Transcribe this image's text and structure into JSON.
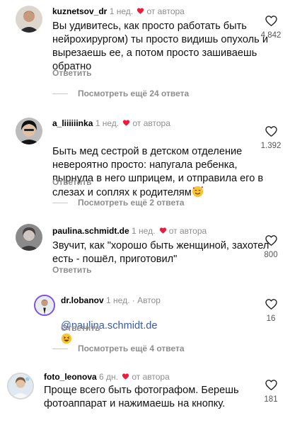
{
  "comments": [
    {
      "username": "kuznetsov_dr",
      "time": "1 нед.",
      "author_like": "от автора",
      "text": "Вы удивитесь, как просто работать быть нейрохирургом) ты просто видишь опухоль и вырезаешь ее, а потом просто зашиваешь обратно",
      "reply_label": "Ответить",
      "likes": "4.842",
      "more_replies": "Посмотреть ещё 24 ответа"
    },
    {
      "username": "a_liiiiiinka",
      "time": "1 нед.",
      "author_like": "от автора",
      "text": "Быть мед сестрой в детском отделение невероятно просто: напугала ребенка, пырнула в него шприцем, и отправила его в слезах и соплях к родителям",
      "emoji": "smiling-face-with-hearts",
      "reply_label": "Ответить",
      "likes": "1.392",
      "more_replies": "Посмотреть ещё 2 ответа"
    },
    {
      "username": "paulina.schmidt.de",
      "time": "1 нед.",
      "author_like": "от автора",
      "text": "Звучит, как \"хорошо быть женщиной, захотел есть - пошёл, приготовил\"",
      "reply_label": "Ответить",
      "likes": "800",
      "reply": {
        "username": "dr.lobanov",
        "time": "1 нед.",
        "badge": "Автор",
        "mention": "@paulina.schmidt.de",
        "emoji": "grinning-squinting-face",
        "reply_label": "Ответить",
        "likes": "16"
      },
      "more_replies": "Посмотреть ещё 4 ответа"
    },
    {
      "username": "foto_leonova",
      "time": "6 дн.",
      "author_like": "от автора",
      "text": "Проще всего быть фотографом. Берешь фотоаппарат и нажимаешь на кнопку.",
      "likes": "181"
    }
  ],
  "colors": {
    "heart_red": "#ed1c3c",
    "muted_text": "#8e8e8e",
    "mention_blue": "#3a59a8",
    "author_ring": "#7b4ef0"
  }
}
